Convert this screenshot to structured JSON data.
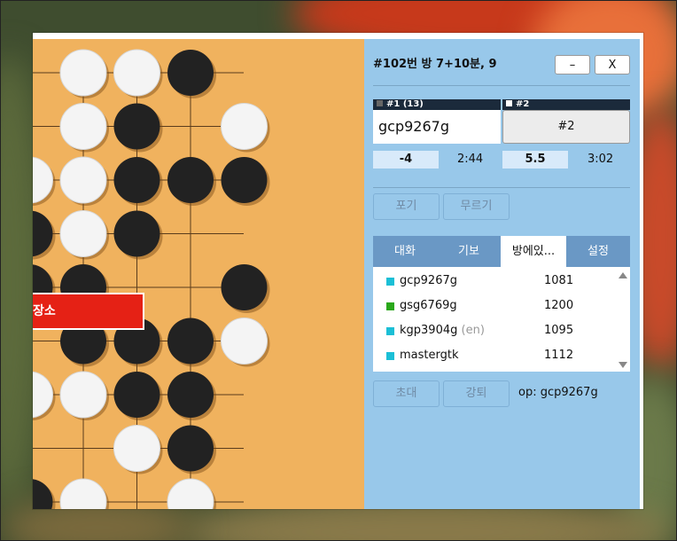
{
  "room": {
    "title": "#102번 방   7+10분, 9",
    "minimize_label": "–",
    "close_label": "X"
  },
  "players": {
    "p1": {
      "header": "#1    (13)",
      "name": "gcp9267g",
      "score": "-4",
      "clock": "2:44"
    },
    "p2": {
      "header": "#2",
      "name": "#2",
      "score": "5.5",
      "clock": "3:02"
    }
  },
  "actions": {
    "resign": "포기",
    "undo": "무르기",
    "invite": "초대",
    "kick": "강퇴"
  },
  "tabs": [
    "대화",
    "기보",
    "방에있...",
    "설정"
  ],
  "users": [
    {
      "name": "gcp9267g",
      "lang": "",
      "rating": "1081",
      "color": "#1bbfd6"
    },
    {
      "name": "gsg6769g",
      "lang": "",
      "rating": "1200",
      "color": "#2aa81a"
    },
    {
      "name": "kgp3904g",
      "lang": "(en)",
      "rating": "1095",
      "color": "#1bbfd6"
    },
    {
      "name": "mastergtk",
      "lang": "",
      "rating": "1112",
      "color": "#1bbfd6"
    }
  ],
  "operator": "op: gcp9267g",
  "overlay_text": "장소",
  "colors": {
    "board": "#f0b25e",
    "panel": "#98c8ea",
    "tab": "#6a98c5",
    "alert": "#e52115"
  },
  "board": {
    "stones": [
      {
        "c": 0,
        "r": 0,
        "s": "w"
      },
      {
        "c": 1,
        "r": 0,
        "s": "w"
      },
      {
        "c": 2,
        "r": 0,
        "s": "b"
      },
      {
        "c": 0,
        "r": 1,
        "s": "w"
      },
      {
        "c": 1,
        "r": 1,
        "s": "b"
      },
      {
        "c": 3,
        "r": 1,
        "s": "w"
      },
      {
        "c": -1,
        "r": 2,
        "s": "w"
      },
      {
        "c": 0,
        "r": 2,
        "s": "w"
      },
      {
        "c": 1,
        "r": 2,
        "s": "b"
      },
      {
        "c": 2,
        "r": 2,
        "s": "b"
      },
      {
        "c": 3,
        "r": 2,
        "s": "b"
      },
      {
        "c": -1,
        "r": 3,
        "s": "b"
      },
      {
        "c": 0,
        "r": 3,
        "s": "w"
      },
      {
        "c": 1,
        "r": 3,
        "s": "b"
      },
      {
        "c": -1,
        "r": 4,
        "s": "b"
      },
      {
        "c": 0,
        "r": 4,
        "s": "b"
      },
      {
        "c": 3,
        "r": 4,
        "s": "b"
      },
      {
        "c": 0,
        "r": 5,
        "s": "b"
      },
      {
        "c": 1,
        "r": 5,
        "s": "b"
      },
      {
        "c": 2,
        "r": 5,
        "s": "b"
      },
      {
        "c": 3,
        "r": 5,
        "s": "w"
      },
      {
        "c": -1,
        "r": 6,
        "s": "w"
      },
      {
        "c": 0,
        "r": 6,
        "s": "w"
      },
      {
        "c": 1,
        "r": 6,
        "s": "b"
      },
      {
        "c": 2,
        "r": 6,
        "s": "b"
      },
      {
        "c": 1,
        "r": 7,
        "s": "w"
      },
      {
        "c": 2,
        "r": 7,
        "s": "b"
      },
      {
        "c": -1,
        "r": 8,
        "s": "b"
      },
      {
        "c": 0,
        "r": 8,
        "s": "w"
      },
      {
        "c": 2,
        "r": 8,
        "s": "w"
      }
    ]
  }
}
